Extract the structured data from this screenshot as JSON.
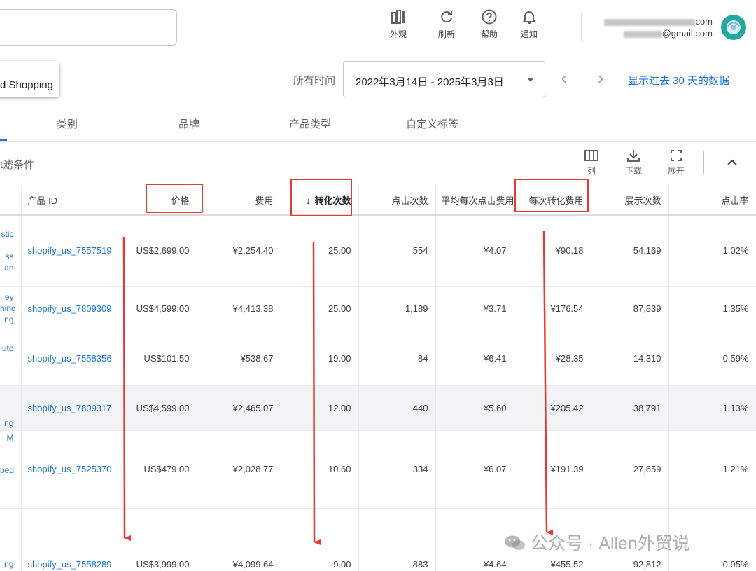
{
  "header": {
    "actions": [
      {
        "label": "外观",
        "icon": "appearance-icon"
      },
      {
        "label": "刷新",
        "icon": "refresh-icon"
      },
      {
        "label": "帮助",
        "icon": "help-icon"
      },
      {
        "label": "通知",
        "icon": "bell-icon"
      }
    ],
    "account_line1_suffix": "com",
    "account_line2": "@gmail.com"
  },
  "toolbar": {
    "campaign_chip": "d Shopping",
    "time_label": "所有时间",
    "date_range": "2022年3月14日 - 2025年3月3日",
    "recent_link": "显示过去 30 天的数据"
  },
  "tabs": [
    "类别",
    "品牌",
    "产品类型",
    "自定义标签"
  ],
  "filter": {
    "label": "t滤条件",
    "tools": [
      {
        "label": "列",
        "icon": "columns-icon"
      },
      {
        "label": "下载",
        "icon": "download-icon"
      },
      {
        "label": "展开",
        "icon": "expand-icon"
      }
    ]
  },
  "table": {
    "columns": [
      "产品 ID",
      "价格",
      "费用",
      "转化次数",
      "点击次数",
      "平均每次点击费用",
      "每次转化费用",
      "展示次数",
      "点击率"
    ],
    "sort_column": "转化次数",
    "sort_direction": "descending",
    "rows": [
      {
        "title": [
          "stic",
          "",
          "ss",
          "an"
        ],
        "id": "shopify_us_7557519",
        "price": "US$2,699.00",
        "cost": "¥2,254.40",
        "conv": "25.00",
        "clicks": "554",
        "cpc": "¥4.07",
        "cpa": "¥90.18",
        "impr": "54,169",
        "ctr": "1.02%"
      },
      {
        "title": [
          "ey",
          "hing",
          "ng"
        ],
        "id": "shopify_us_7809309",
        "price": "US$4,599.00",
        "cost": "¥4,413.38",
        "conv": "25.00",
        "clicks": "1,189",
        "cpc": "¥3.71",
        "cpa": "¥176.54",
        "impr": "87,839",
        "ctr": "1.35%"
      },
      {
        "title": [
          "uto",
          "",
          ""
        ],
        "id": "shopify_us_7558356",
        "price": "US$101.50",
        "cost": "¥538.67",
        "conv": "19.00",
        "clicks": "84",
        "cpc": "¥6.41",
        "cpa": "¥28.35",
        "impr": "14,310",
        "ctr": "0.59%"
      },
      {
        "title": [
          "",
          "",
          "ng"
        ],
        "id": "shopify_us_7809317",
        "price": "US$4,599.00",
        "cost": "¥2,465.07",
        "conv": "12.00",
        "clicks": "440",
        "cpc": "¥5.60",
        "cpa": "¥205.42",
        "impr": "38,791",
        "ctr": "1.13%"
      },
      {
        "title": [
          "M",
          "",
          "ped",
          ""
        ],
        "id": "shopify_us_7525370",
        "price": "US$479.00",
        "cost": "¥2,028.77",
        "conv": "10.60",
        "clicks": "334",
        "cpc": "¥6.07",
        "cpa": "¥191.39",
        "impr": "27,659",
        "ctr": "1.21%"
      },
      {
        "title": [
          "",
          "",
          "ng"
        ],
        "id": "shopify_us_7558289",
        "price": "US$3,999.00",
        "cost": "¥4,099.64",
        "conv": "9.00",
        "clicks": "883",
        "cpc": "¥4.64",
        "cpa": "¥455.52",
        "impr": "92,812",
        "ctr": "0.95%"
      }
    ]
  },
  "watermark": "公众号 · Allen外贸说",
  "colors": {
    "accent": "#1a73e8",
    "annotation": "#e53935",
    "avatar": "#1fa9a0"
  }
}
